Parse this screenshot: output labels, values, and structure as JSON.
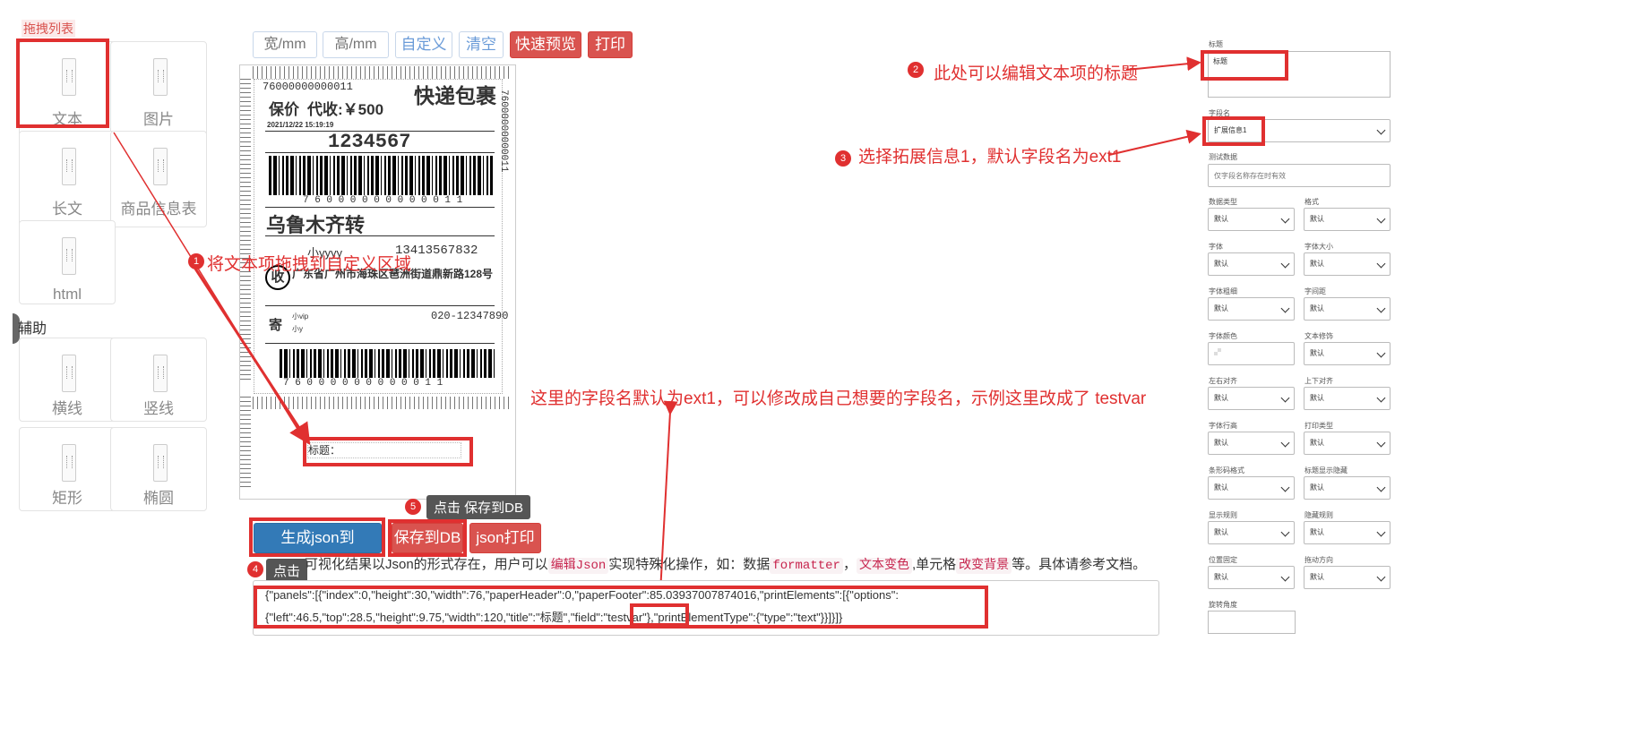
{
  "palette": {
    "title": "拖拽列表",
    "items": [
      "文本",
      "图片",
      "长文",
      "商品信息表",
      "html"
    ],
    "aux_title": "辅助",
    "aux_items": [
      "横线",
      "竖线",
      "矩形",
      "椭圆"
    ]
  },
  "toolbar": {
    "width_placeholder": "宽/mm",
    "height_placeholder": "高/mm",
    "custom": "自定义",
    "clear": "清空",
    "quick_preview": "快速预览",
    "print": "打印"
  },
  "label": {
    "tracking_top": "76000000000011",
    "express": "快递包裹",
    "insure": "保价",
    "cod": "代收:￥500",
    "datetime": "2021/12/22 15:19:19",
    "code": "1234567",
    "barcode_digits": "7 6 0 0 0 0 0 0 0 0 0 0 1 1",
    "side_code": "76000000000011",
    "city": "乌鲁木齐转",
    "recv_char": "收",
    "recv_name": "小yyyy",
    "recv_phone": "13413567832",
    "recv_addr": "广东省广州市海珠区琶洲街道鼎新路128号",
    "send_char": "寄",
    "send_name": "小vip",
    "send_name2": "小y",
    "send_phone": "020-12347890",
    "bottom_digits": "7 6 0 0 0 0 0 0 0 0 0 0 1 1",
    "text_field": "标题："
  },
  "annotations": {
    "a1": "将文本项拖拽到自定义区域",
    "a2": "此处可以编辑文本项的标题",
    "a3": "选择拓展信息1，默认字段名为ext1",
    "a_field": "这里的字段名默认为ext1，可以修改成自己想要的字段名，示例这里改成了 testvar",
    "a4": "点击",
    "a5": "点击 保存到DB",
    "n1": "1",
    "n2": "2",
    "n3": "3",
    "n4": "4",
    "n5": "5"
  },
  "actions": {
    "gen_json": "生成json到textarea",
    "save_db": "保存到DB",
    "json_print": "json打印"
  },
  "desc": {
    "prefix": "可视化结果以Json的形式存在，用户可以",
    "c1": "编辑Json",
    "mid1": "实现特殊化操作，如：数据",
    "c2": "formatter",
    "sep": "，",
    "c3": "文本变色",
    "mid2": ",单元格",
    "c4": "改变背景",
    "suffix": "等。具体请参考文档。"
  },
  "json_text": {
    "line1": "{\"panels\":[{\"index\":0,\"height\":30,\"width\":76,\"paperHeader\":0,\"paperFooter\":85.03937007874016,\"printElements\":[{\"options\":",
    "line2a": "{\"left\":46.5,\"top\":28.5,\"height\":9.75,\"width\":120,\"title\":\"标题\",\"field\":",
    "line2b": "\"testvar\"",
    "line2c": "},\"printElementType\":{\"type\":\"text\"}}]}]}"
  },
  "props": {
    "title_label": "标题",
    "title_value": "标题",
    "field_label": "字段名",
    "field_value": "扩展信息1",
    "test_label": "测试数据",
    "test_placeholder": "仅字段名称存在时有效",
    "rows": [
      [
        "数据类型",
        "格式"
      ],
      [
        "字体",
        "字体大小"
      ],
      [
        "字体粗细",
        "字间距"
      ],
      [
        "字体颜色",
        "文本修饰"
      ],
      [
        "左右对齐",
        "上下对齐"
      ],
      [
        "字体行高",
        "打印类型"
      ],
      [
        "条形码格式",
        "标题显示隐藏"
      ],
      [
        "显示规则",
        "隐藏规则"
      ],
      [
        "位置固定",
        "拖动方向"
      ]
    ],
    "default": "默认",
    "rotate_label": "旋转角度"
  }
}
